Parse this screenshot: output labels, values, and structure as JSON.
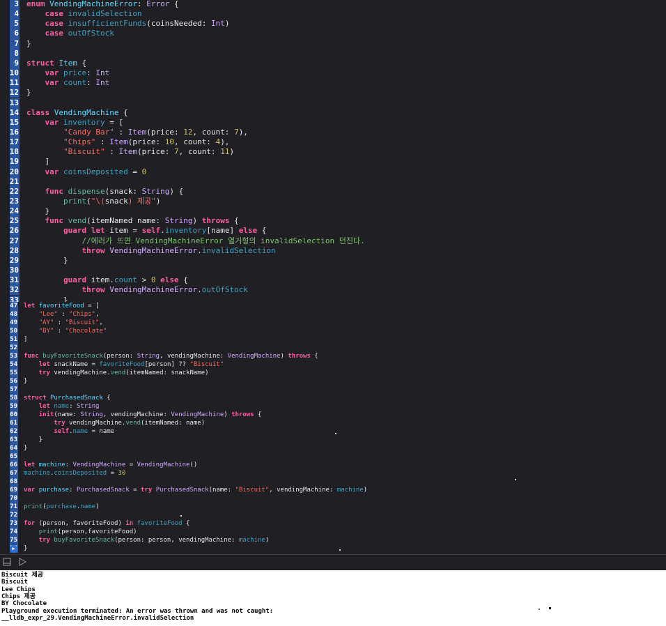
{
  "pane_top": {
    "lines": [
      {
        "n": "3",
        "html": "<span class=\"kw\">enum</span> <span class=\"tn\">VendingMachineError</span>: <span class=\"ty\">Error</span> {"
      },
      {
        "n": "4",
        "html": "    <span class=\"kw\">case</span> <span class=\"pr\">invalidSelection</span>"
      },
      {
        "n": "5",
        "html": "    <span class=\"kw\">case</span> <span class=\"pr\">insufficientFunds</span>(coinsNeeded: <span class=\"ty\">Int</span>)"
      },
      {
        "n": "6",
        "html": "    <span class=\"kw\">case</span> <span class=\"pr\">outOfStock</span>"
      },
      {
        "n": "7",
        "html": "}"
      },
      {
        "n": "8",
        "html": ""
      },
      {
        "n": "9",
        "html": "<span class=\"kw\">struct</span> <span class=\"tn\">Item</span> {"
      },
      {
        "n": "10",
        "html": "    <span class=\"kw\">var</span> <span class=\"pr\">price</span>: <span class=\"ty\">Int</span>"
      },
      {
        "n": "11",
        "html": "    <span class=\"kw\">var</span> <span class=\"pr\">count</span>: <span class=\"ty\">Int</span>"
      },
      {
        "n": "12",
        "html": "}"
      },
      {
        "n": "13",
        "html": ""
      },
      {
        "n": "14",
        "html": "<span class=\"kw\">class</span> <span class=\"tn\">VendingMachine</span> {"
      },
      {
        "n": "15",
        "html": "    <span class=\"kw\">var</span> <span class=\"pr\">inventory</span> = ["
      },
      {
        "n": "16",
        "html": "        <span class=\"str\">\"Candy Bar\"</span> : <span class=\"ty\">Item</span>(price: <span class=\"num\">12</span>, count: <span class=\"num\">7</span>),"
      },
      {
        "n": "17",
        "html": "        <span class=\"str\">\"Chips\"</span> : <span class=\"ty\">Item</span>(price: <span class=\"num\">10</span>, count: <span class=\"num\">4</span>),"
      },
      {
        "n": "18",
        "html": "        <span class=\"str\">\"Biscuit\"</span> : <span class=\"ty\">Item</span>(price: <span class=\"num\">7</span>, count: <span class=\"num\">11</span>)"
      },
      {
        "n": "19",
        "html": "    ]"
      },
      {
        "n": "20",
        "html": "    <span class=\"kw\">var</span> <span class=\"pr\">coinsDeposited</span> = <span class=\"num\">0</span>"
      },
      {
        "n": "21",
        "html": ""
      },
      {
        "n": "22",
        "html": "    <span class=\"kw\">func</span> <span class=\"fn\">dispense</span>(snack: <span class=\"ty\">String</span>) {"
      },
      {
        "n": "23",
        "html": "        <span class=\"fn\">print</span>(<span class=\"str\">\"\\(</span>snack<span class=\"str\">) 제공\"</span>)"
      },
      {
        "n": "24",
        "html": "    }"
      },
      {
        "n": "25",
        "html": "    <span class=\"kw\">func</span> <span class=\"fn\">vend</span>(itemNamed name: <span class=\"ty\">String</span>) <span class=\"kw\">throws</span> {"
      },
      {
        "n": "26",
        "html": "        <span class=\"kw\">guard</span> <span class=\"kw\">let</span> item = <span class=\"kw\">self</span>.<span class=\"pr\">inventory</span>[name] <span class=\"kw\">else</span> {"
      },
      {
        "n": "27",
        "html": "            <span class=\"cmk\">//에러가 뜨면 VendingMachineError 열거형의 invalidSelection 던진다.</span>"
      },
      {
        "n": "28",
        "html": "            <span class=\"kw\">throw</span> <span class=\"ty\">VendingMachineError</span>.<span class=\"pr\">invalidSelection</span>"
      },
      {
        "n": "29",
        "html": "        }"
      },
      {
        "n": "30",
        "html": ""
      },
      {
        "n": "31",
        "html": "        <span class=\"kw\">guard</span> item.<span class=\"pr\">count</span> &gt; <span class=\"num\">0</span> <span class=\"kw\">else</span> {"
      },
      {
        "n": "32",
        "html": "            <span class=\"kw\">throw</span> <span class=\"ty\">VendingMachineError</span>.<span class=\"pr\">outOfStock</span>"
      },
      {
        "n": "33",
        "html": "        }"
      }
    ]
  },
  "pane_bottom": {
    "lines": [
      {
        "n": "47",
        "html": "<span class=\"kw\">let</span> <span class=\"tn\">favoriteFood</span> = ["
      },
      {
        "n": "48",
        "html": "    <span class=\"str\">\"Lee\"</span> : <span class=\"str\">\"Chips\"</span>,"
      },
      {
        "n": "49",
        "html": "    <span class=\"str\">\"AY\"</span> : <span class=\"str\">\"Biscuit\"</span>,"
      },
      {
        "n": "50",
        "html": "    <span class=\"str\">\"BY\"</span> : <span class=\"str\">\"Chocolate\"</span>"
      },
      {
        "n": "51",
        "html": "]"
      },
      {
        "n": "52",
        "html": ""
      },
      {
        "n": "53",
        "html": "<span class=\"kw\">func</span> <span class=\"fn\">buyFavoriteSnack</span>(person: <span class=\"ty\">String</span>, vendingMachine: <span class=\"ty\">VendingMachine</span>) <span class=\"kw\">throws</span> {"
      },
      {
        "n": "54",
        "html": "    <span class=\"kw\">let</span> snackName = <span class=\"pr\">favoriteFood</span>[person] ?? <span class=\"str\">\"Biscuit\"</span>"
      },
      {
        "n": "55",
        "html": "    <span class=\"kw\">try</span> vendingMachine.<span class=\"fn\">vend</span>(itemNamed: snackName)"
      },
      {
        "n": "56",
        "html": "}"
      },
      {
        "n": "57",
        "html": ""
      },
      {
        "n": "58",
        "html": "<span class=\"kw\">struct</span> <span class=\"tn\">PurchasedSnack</span> {"
      },
      {
        "n": "59",
        "html": "    <span class=\"kw\">let</span> <span class=\"pr\">name</span>: <span class=\"ty\">String</span>"
      },
      {
        "n": "60",
        "html": "    <span class=\"kw\">init</span>(name: <span class=\"ty\">String</span>, vendingMachine: <span class=\"ty\">VendingMachine</span>) <span class=\"kw\">throws</span> {"
      },
      {
        "n": "61",
        "html": "        <span class=\"kw\">try</span> vendingMachine.<span class=\"fn\">vend</span>(itemNamed: name)"
      },
      {
        "n": "62",
        "html": "        <span class=\"kw\">self</span>.<span class=\"pr\">name</span> = name"
      },
      {
        "n": "63",
        "html": "    }"
      },
      {
        "n": "64",
        "html": "}"
      },
      {
        "n": "65",
        "html": ""
      },
      {
        "n": "66",
        "html": "<span class=\"kw\">let</span> <span class=\"tn\">machine</span>: <span class=\"ty\">VendingMachine</span> = <span class=\"ty\">VendingMachine</span>()"
      },
      {
        "n": "67",
        "html": "<span class=\"pr\">machine</span>.<span class=\"pr\">coinsDeposited</span> = <span class=\"num\">30</span>"
      },
      {
        "n": "68",
        "html": ""
      },
      {
        "n": "69",
        "html": "<span class=\"kw\">var</span> <span class=\"tn\">purchase</span>: <span class=\"ty\">PurchasedSnack</span> = <span class=\"kw\">try</span> <span class=\"ty\">PurchasedSnack</span>(name: <span class=\"str\">\"Biscuit\"</span>, vendingMachine: <span class=\"pr\">machine</span>)"
      },
      {
        "n": "70",
        "html": ""
      },
      {
        "n": "71",
        "html": "<span class=\"fn\">print</span>(<span class=\"pr\">purchase</span>.<span class=\"pr\">name</span>)"
      },
      {
        "n": "72",
        "html": ""
      },
      {
        "n": "73",
        "html": "<span class=\"kw\">for</span> (person, favoriteFood) <span class=\"kw\">in</span> <span class=\"pr\">favoriteFood</span> {"
      },
      {
        "n": "74",
        "html": "    <span class=\"fn\">print</span>(person,favoriteFood)"
      },
      {
        "n": "75",
        "html": "    <span class=\"kw\">try</span> <span class=\"fn\">buyFavoriteSnack</span>(person: person, vendingMachine: <span class=\"pr\">machine</span>)"
      },
      {
        "n": "76",
        "html": "}"
      }
    ]
  },
  "console": {
    "lines": [
      "Biscuit 제공",
      "Biscuit",
      "Lee Chips",
      "Chips 제공",
      "BY Chocolate",
      "Playground execution terminated: An error was thrown and was not caught:",
      "__lldb_expr_29.VendingMachineError.invalidSelection"
    ]
  },
  "toolbar": {
    "hide_icon": "panel-toggle-icon",
    "run_icon": "play-icon"
  },
  "colors": {
    "editor_bg": "#1f1f24",
    "line_number_highlight": "#2a55a0",
    "keyword": "#fc5fa3",
    "string": "#fc6a5d",
    "number": "#d0bf69",
    "console_bg": "#ffffff"
  }
}
